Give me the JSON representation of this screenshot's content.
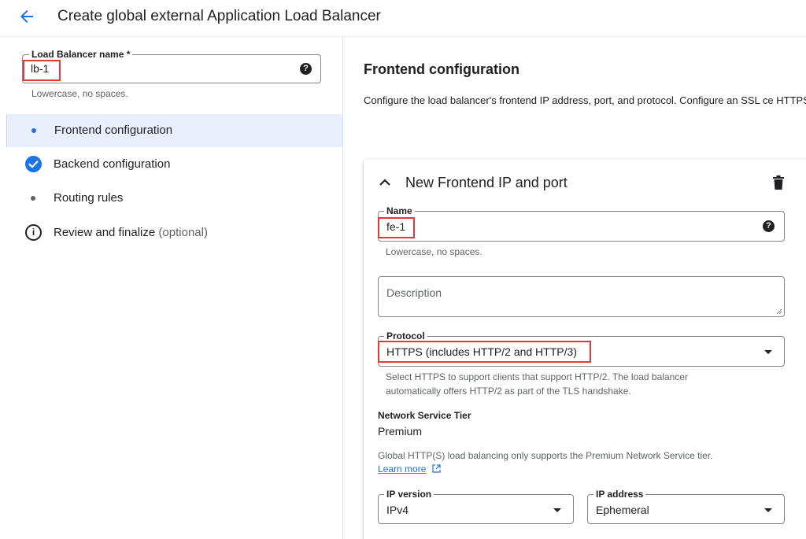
{
  "header": {
    "title": "Create global external Application Load Balancer"
  },
  "lb_name": {
    "label": "Load Balancer name *",
    "value": "lb-1",
    "hint": "Lowercase, no spaces."
  },
  "steps": [
    {
      "label": "Frontend configuration",
      "icon": "dot-icon",
      "active": true
    },
    {
      "label": "Backend configuration",
      "icon": "check-circle-icon",
      "active": false
    },
    {
      "label": "Routing rules",
      "icon": "dot-icon",
      "active": false
    },
    {
      "label": "Review and finalize",
      "suffix": "(optional)",
      "icon": "info-icon",
      "active": false
    }
  ],
  "frontend": {
    "title": "Frontend configuration",
    "description": "Configure the load balancer's frontend IP address, port, and protocol. Configure an SSL ce HTTPS."
  },
  "card": {
    "title": "New Frontend IP and port",
    "name": {
      "label": "Name",
      "value": "fe-1",
      "hint": "Lowercase, no spaces."
    },
    "description": {
      "placeholder": "Description"
    },
    "protocol": {
      "label": "Protocol",
      "value": "HTTPS (includes HTTP/2 and HTTP/3)",
      "hint": "Select HTTPS to support clients that support HTTP/2. The load balancer automatically offers HTTP/2 as part of the TLS handshake."
    },
    "tier": {
      "label": "Network Service Tier",
      "value": "Premium",
      "note": "Global HTTP(S) load balancing only supports the Premium Network Service tier.",
      "learn_more": "Learn more"
    },
    "ip_version": {
      "label": "IP version",
      "value": "IPv4"
    },
    "ip_address": {
      "label": "IP address",
      "value": "Ephemeral"
    }
  },
  "colors": {
    "accent": "#1a73e8",
    "highlight_box": "#e53935",
    "active_nav_bg": "#e8f0fe"
  }
}
